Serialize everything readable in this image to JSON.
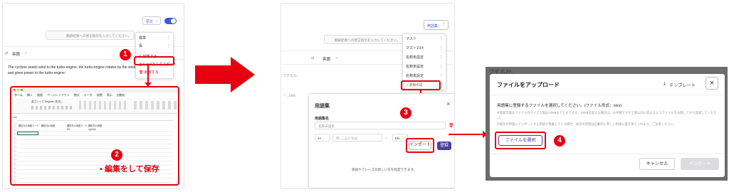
{
  "step1": {
    "dropdown_label": "原文",
    "placeholder_text": "翻訳結果への修正指示を入力してください。",
    "menu_items": [
      "標準",
      "長",
      "編集する",
      "Excelでエクスポート",
      "削除する"
    ],
    "source_lang": "英語",
    "source_text": "The cyclone sends wind to the turbo-engine, the turbo-engine rotates by the wind and gives power to the turbo-engine."
  },
  "excel": {
    "tabs": [
      "ホーム",
      "挿入",
      "描画",
      "ページレイアウト",
      "数式",
      "データ",
      "校閲",
      "表示",
      "自動化"
    ],
    "font_name": "游ゴシック Regular (本文)",
    "headers": [
      "翻訳元の用語コード",
      "翻訳元の用語",
      "翻訳先の用語コード",
      "翻訳先の用語"
    ],
    "row_values": [
      "EN",
      "cyclone"
    ],
    "cell_ref": "A1",
    "note": "編集をして保存"
  },
  "step3": {
    "dropdown_label": "用語集",
    "placeholder_text": "翻訳結果への修正指示を入力してください。",
    "menu_items": [
      "マスト",
      "マスト1/14",
      "名称未設定",
      "名称未設定",
      "名称未設定"
    ],
    "new_item": "+ 新規作成",
    "source_lang": "英語",
    "partial_text": "ブするか、",
    "partial_text2": "ー _utils",
    "dialog": {
      "title": "用語集",
      "name_label": "用語集名",
      "name_placeholder": "名称未設定",
      "lang_from": "JA",
      "example_placeholder": "例: こんにちは",
      "arrow": "→",
      "lang_to": "EN",
      "import_label": "インポート",
      "register_label": "登録",
      "empty_message": "単語やフレーズの新しい方を指定できます。"
    }
  },
  "upload": {
    "bg_text": "ブするか、",
    "title": "ファイルをアップロード",
    "template_label": "テンプレート",
    "instruction": "用語集に登録するファイルを選択してください。(ファイル形式：xlsx)",
    "note1": "※登録可能なファイルのサイズ上限は10MBまでとなります。10MBを超える場合は、お手数ですが上限以内に収まるようファイルを分割してから登録してください。",
    "note2": "※既存の用語にインポートする用語が重複している場合、既存の用語は自動的に新しい用語に書き換えられます。ご注意ください。",
    "select_label": "ファイルを選択",
    "cancel_label": "キャンセル",
    "import_label": "インポート"
  },
  "badges": [
    "1",
    "2",
    "3",
    "4"
  ],
  "colors": {
    "accent": "#e60012",
    "purple": "#4b3c9e",
    "toggle": "#3a5bd9"
  }
}
